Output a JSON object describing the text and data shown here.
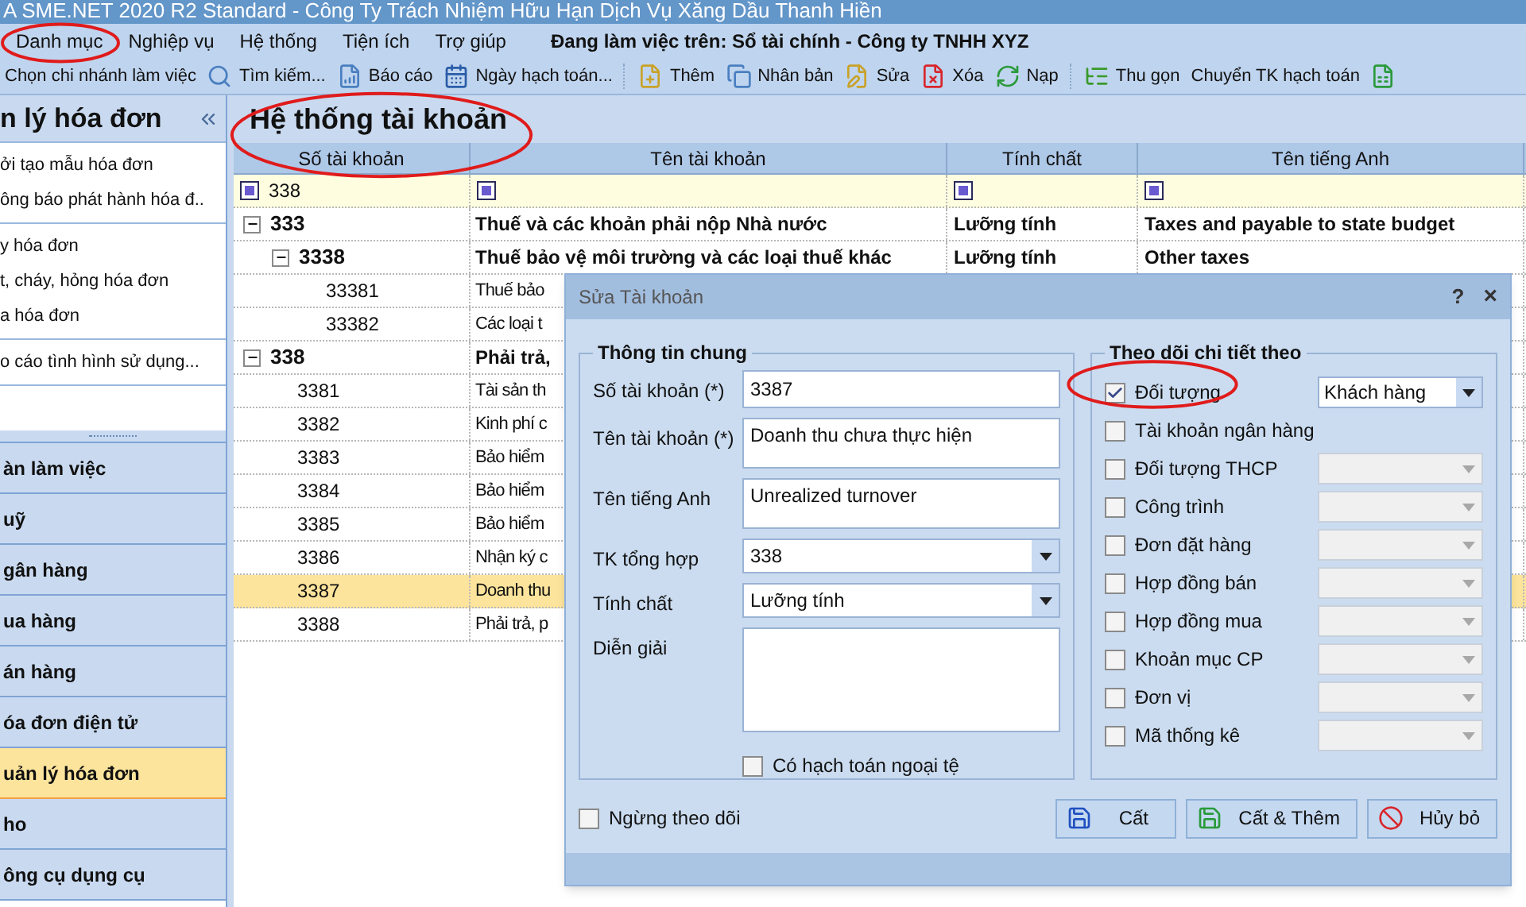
{
  "window": {
    "title": "A SME.NET 2020 R2 Standard - Công Ty Trách Nhiệm Hữu Hạn Dịch Vụ Xăng Dầu Thanh Hiền"
  },
  "menu": [
    {
      "label": "Danh mục"
    },
    {
      "label": "Nghiệp vụ"
    },
    {
      "label": "Hệ thống"
    },
    {
      "label": "Tiện ích"
    },
    {
      "label": "Trợ giúp"
    }
  ],
  "context": "Đang làm việc trên: Sổ tài chính - Công ty TNHH XYZ",
  "toolbar": [
    {
      "items": [
        {
          "label": "Chọn chi nhánh làm việc",
          "kind": "text"
        },
        {
          "label": "Tìm kiếm...",
          "kind": "search"
        },
        {
          "label": "Báo cáo",
          "kind": "report"
        },
        {
          "label": "Ngày hạch toán...",
          "kind": "calendar"
        }
      ]
    },
    {
      "items": [
        {
          "label": "Thêm",
          "kind": "add"
        },
        {
          "label": "Nhân bản",
          "kind": "copy"
        },
        {
          "label": "Sửa",
          "kind": "edit"
        },
        {
          "label": "Xóa",
          "kind": "delete"
        },
        {
          "label": "Nạp",
          "kind": "reload"
        }
      ]
    },
    {
      "items": [
        {
          "label": "Thu gọn",
          "kind": "collapse"
        },
        {
          "label": "Chuyển TK hạch toán",
          "kind": "text"
        },
        {
          "kind": "export"
        }
      ]
    }
  ],
  "sidebar": {
    "title": "n lý hóa đơn",
    "groups": [
      {
        "items": [
          "ởi tạo mẫu hóa đơn",
          "ông báo phát hành hóa đ.."
        ]
      },
      {
        "items": [
          "y hóa đơn",
          "t, cháy, hỏng hóa đơn",
          "a hóa đơn"
        ]
      },
      {
        "items": [
          "o cáo tình hình sử dụng..."
        ]
      }
    ],
    "nav": [
      {
        "label": "àn làm việc",
        "selected": false
      },
      {
        "label": "uỹ",
        "selected": false
      },
      {
        "label": "gân hàng",
        "selected": false
      },
      {
        "label": "ua hàng",
        "selected": false
      },
      {
        "label": "án hàng",
        "selected": false
      },
      {
        "label": "óa đơn điện tử",
        "selected": false
      },
      {
        "label": "uản lý hóa đơn",
        "selected": true
      },
      {
        "label": "ho",
        "selected": false
      },
      {
        "label": "ông cụ dụng cụ",
        "selected": false
      }
    ]
  },
  "main": {
    "title": "Hệ thống tài khoản",
    "columns": [
      "Số tài khoản",
      "Tên tài khoản",
      "Tính chất",
      "Tên tiếng Anh"
    ],
    "filter_text": "338",
    "rows": [
      {
        "number": "333",
        "name": "Thuế và các khoản phải nộp Nhà nước",
        "nature": "Lưỡng tính",
        "english": "Taxes and payable to state budget",
        "expanded": true,
        "selected": false,
        "children": [
          {
            "number": "3338",
            "name": "Thuế bảo vệ môi trường và các loại thuế khác",
            "nature": "Lưỡng tính",
            "english": "Other taxes",
            "expanded": true,
            "selected": false,
            "children": [
              {
                "number": "33381",
                "name": "Thuế bảo",
                "selected": false
              },
              {
                "number": "33382",
                "name": "Các loại t",
                "selected": false
              }
            ]
          }
        ]
      },
      {
        "number": "338",
        "name": "Phải trả,",
        "expanded": true,
        "selected": false,
        "children": [
          {
            "number": "3381",
            "name": "Tài sản th",
            "selected": false
          },
          {
            "number": "3382",
            "name": "Kinh phí c",
            "selected": false
          },
          {
            "number": "3383",
            "name": "Bảo hiểm",
            "selected": false
          },
          {
            "number": "3384",
            "name": "Bảo hiểm",
            "selected": false
          },
          {
            "number": "3385",
            "name": "Bảo hiểm",
            "selected": false
          },
          {
            "number": "3386",
            "name": "Nhận ký c",
            "selected": false
          },
          {
            "number": "3387",
            "name": "Doanh thu",
            "selected": true
          },
          {
            "number": "3388",
            "name": "Phải trả, p",
            "selected": false
          }
        ]
      }
    ]
  },
  "dialog": {
    "title": "Sửa Tài khoản",
    "help": "?",
    "close": "×",
    "general": {
      "title": "Thông tin chung",
      "fields": [
        {
          "label": "Số tài khoản (*)",
          "value": "3387",
          "kind": "text"
        },
        {
          "label": "Tên tài khoản (*)",
          "value": "Doanh thu chưa thực hiện",
          "kind": "textarea"
        },
        {
          "label": "Tên tiếng Anh",
          "value": "Unrealized turnover",
          "kind": "textarea"
        },
        {
          "label": "TK tổng hợp",
          "value": "338",
          "kind": "combo"
        },
        {
          "label": "Tính chất",
          "value": "Lưỡng tính",
          "kind": "combo"
        },
        {
          "label": "Diễn giải",
          "kind": "memo"
        }
      ],
      "foreign_currency": {
        "label": "Có hạch toán ngoại tệ",
        "checked": false
      }
    },
    "tracking": {
      "title": "Theo dõi chi tiết theo",
      "items": [
        {
          "label": "Đối tượng",
          "checked": true,
          "kind": "combo",
          "value": "Khách hàng",
          "disabled": false
        },
        {
          "label": "Tài khoản ngân hàng",
          "checked": false,
          "kind": "plain"
        },
        {
          "label": "Đối tượng THCP",
          "checked": false,
          "kind": "combo",
          "disabled": true
        },
        {
          "label": "Công trình",
          "checked": false,
          "kind": "combo",
          "disabled": true
        },
        {
          "label": "Đơn đặt hàng",
          "checked": false,
          "kind": "combo",
          "disabled": true
        },
        {
          "label": "Hợp đồng bán",
          "checked": false,
          "kind": "combo",
          "disabled": true
        },
        {
          "label": "Hợp đồng mua",
          "checked": false,
          "kind": "combo",
          "disabled": true
        },
        {
          "label": "Khoản mục CP",
          "checked": false,
          "kind": "combo",
          "disabled": true
        },
        {
          "label": "Đơn vị",
          "checked": false,
          "kind": "combo",
          "disabled": true
        },
        {
          "label": "Mã thống kê",
          "checked": false,
          "kind": "combo",
          "disabled": true
        }
      ]
    },
    "inactive": {
      "label": "Ngừng theo dõi",
      "checked": false
    },
    "buttons": [
      {
        "label": "Cất",
        "kind": "save"
      },
      {
        "label": "Cất & Thêm",
        "kind": "save-add"
      },
      {
        "label": "Hủy bỏ",
        "kind": "cancel"
      }
    ]
  }
}
